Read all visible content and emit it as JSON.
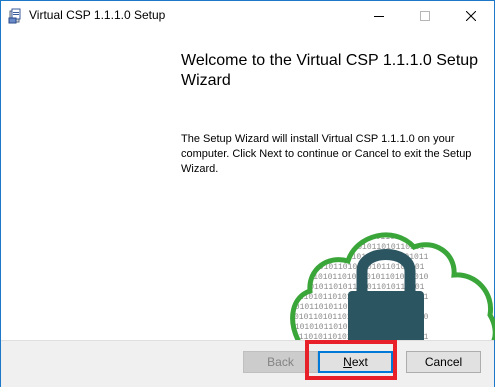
{
  "window": {
    "title": "Virtual CSP 1.1.1.0 Setup",
    "app_icon": "installer-icon",
    "controls": {
      "minimize_icon": "minimize-icon",
      "maximize_icon": "maximize-icon",
      "close_icon": "close-icon"
    }
  },
  "wizard": {
    "heading": "Welcome to the Virtual CSP 1.1.1.0 Setup Wizard",
    "description": "The Setup Wizard will install Virtual CSP 1.1.1.0 on your computer. Click Next to continue or Cancel to exit the Setup Wizard.",
    "illustration": "cloud-lock-icon"
  },
  "buttons": {
    "back": {
      "label": "Back",
      "enabled": false
    },
    "next": {
      "label_underlined": "N",
      "label_rest": "ext",
      "enabled": true,
      "highlighted": true
    },
    "cancel": {
      "label": "Cancel",
      "enabled": true
    }
  },
  "colors": {
    "accent": "#0078d7",
    "highlight": "#e8202a",
    "cloud": "#3aa63a",
    "lock": "#2b5560",
    "binary_text": "#8a8a8a"
  }
}
